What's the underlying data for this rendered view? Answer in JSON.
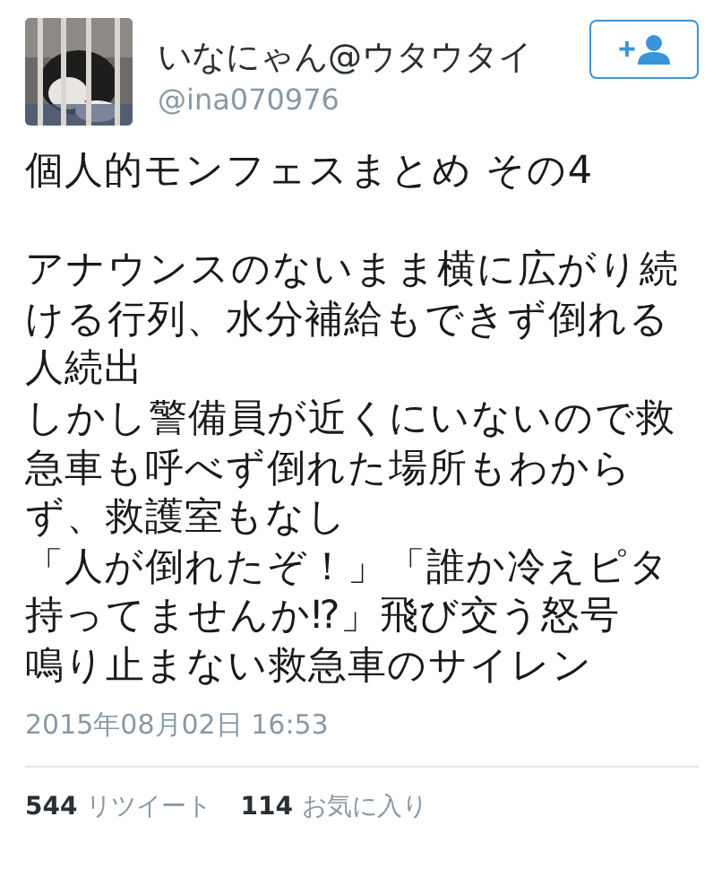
{
  "author": {
    "name": "いなにゃん@ウタウタイ",
    "handle": "@ina070976"
  },
  "follow_button": {
    "icon": "+"
  },
  "tweet": {
    "paragraphs": [
      [
        "個人的モンフェスまとめ その4"
      ],
      [
        "アナウンスのないまま横に広がり続",
        "ける行列、水分補給もできず倒れる",
        "人続出",
        "しかし警備員が近くにいないので救",
        "急車も呼べず倒れた場所もわから",
        "ず、救護室もなし",
        "「人が倒れたぞ！」「誰か冷えピタ",
        "持ってませんか⁉」飛び交う怒号",
        "鳴り止まない救急車のサイレン"
      ]
    ]
  },
  "timestamp": "2015年08月02日 16:53",
  "stats": [
    {
      "count": "544",
      "label": "リツイート"
    },
    {
      "count": "114",
      "label": "お気に入り"
    }
  ]
}
